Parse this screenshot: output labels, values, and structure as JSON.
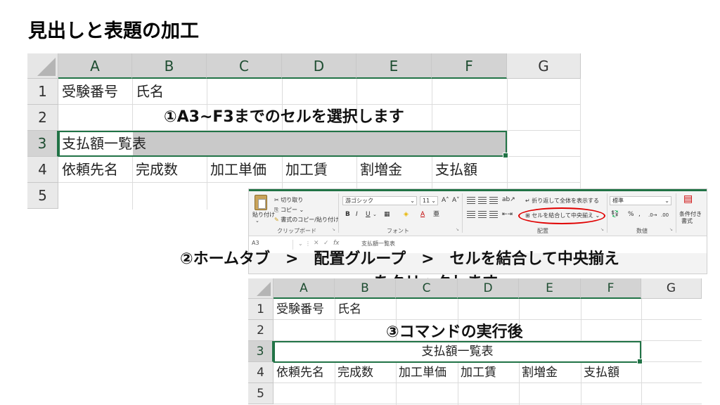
{
  "page": {
    "title": "見出しと表題の加工"
  },
  "sheet1": {
    "columns": [
      "A",
      "B",
      "C",
      "D",
      "E",
      "F",
      "G"
    ],
    "rows": [
      "1",
      "2",
      "3",
      "4",
      "5"
    ],
    "cells": {
      "A1": "受験番号",
      "B1": "氏名",
      "A3": "支払額一覧表",
      "A4": "依頼先名",
      "B4": "完成数",
      "C4": "加工単価",
      "D4": "加工賃",
      "E4": "割増金",
      "F4": "支払額"
    },
    "step_label": "①A3~F3までのセルを選択します"
  },
  "ribbon": {
    "clipboard": {
      "paste": "貼り付け",
      "cut": "切り取り",
      "copy": "コピー",
      "format_painter": "書式のコピー/貼り付け",
      "group_label": "クリップボード"
    },
    "font": {
      "name": "游ゴシック",
      "size": "11",
      "grow": "A˄",
      "shrink": "A˅",
      "bold": "B",
      "italic": "I",
      "underline": "U",
      "group_label": "フォント"
    },
    "alignment": {
      "wrap_text": "折り返して全体を表示する",
      "merge_center": "セルを結合して中央揃え",
      "group_label": "配置"
    },
    "number": {
      "format": "標準",
      "percent": "%",
      "comma": ",",
      "group_label": "数値"
    },
    "styles": {
      "conditional": "条件付き",
      "conditional2": "書式"
    },
    "namebox": "A3",
    "fx": "fx",
    "formula": "支払額一覧表"
  },
  "step2": {
    "line1": "②ホームタブ　>　配置グループ　>　セルを結合して中央揃え",
    "line2": "をクリックします"
  },
  "sheet2": {
    "columns": [
      "A",
      "B",
      "C",
      "D",
      "E",
      "F",
      "G"
    ],
    "rows": [
      "1",
      "2",
      "3",
      "4",
      "5"
    ],
    "cells": {
      "A1": "受験番号",
      "B1": "氏名",
      "A3": "支払額一覧表",
      "A4": "依頼先名",
      "B4": "完成数",
      "C4": "加工単価",
      "D4": "加工賃",
      "E4": "割増金",
      "F4": "支払額"
    },
    "step_label": "③コマンドの実行後"
  }
}
